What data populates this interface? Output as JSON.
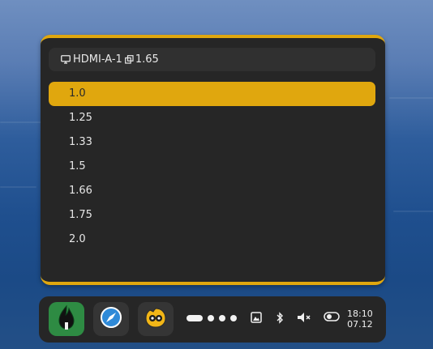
{
  "scale_panel": {
    "output_name": "HDMI-A-1",
    "current_scale": "1.65",
    "options": [
      {
        "label": "1.0",
        "selected": true
      },
      {
        "label": "1.25",
        "selected": false
      },
      {
        "label": "1.33",
        "selected": false
      },
      {
        "label": "1.5",
        "selected": false
      },
      {
        "label": "1.66",
        "selected": false
      },
      {
        "label": "1.75",
        "selected": false
      },
      {
        "label": "2.0",
        "selected": false
      }
    ]
  },
  "taskbar": {
    "apps": [
      {
        "name": "green-flame-app",
        "icon": "flame-icon"
      },
      {
        "name": "blue-compass-app",
        "icon": "compass-icon"
      },
      {
        "name": "yellow-character-app",
        "icon": "character-icon"
      }
    ],
    "workspaces": {
      "active": 1,
      "count": 4
    },
    "tray": [
      "image-icon",
      "bluetooth-icon",
      "volume-muted-icon",
      "toggle-icon"
    ],
    "clock": {
      "time": "18:10",
      "date": "07.12"
    }
  },
  "colors": {
    "accent": "#e0a70e",
    "panel": "#262626"
  }
}
